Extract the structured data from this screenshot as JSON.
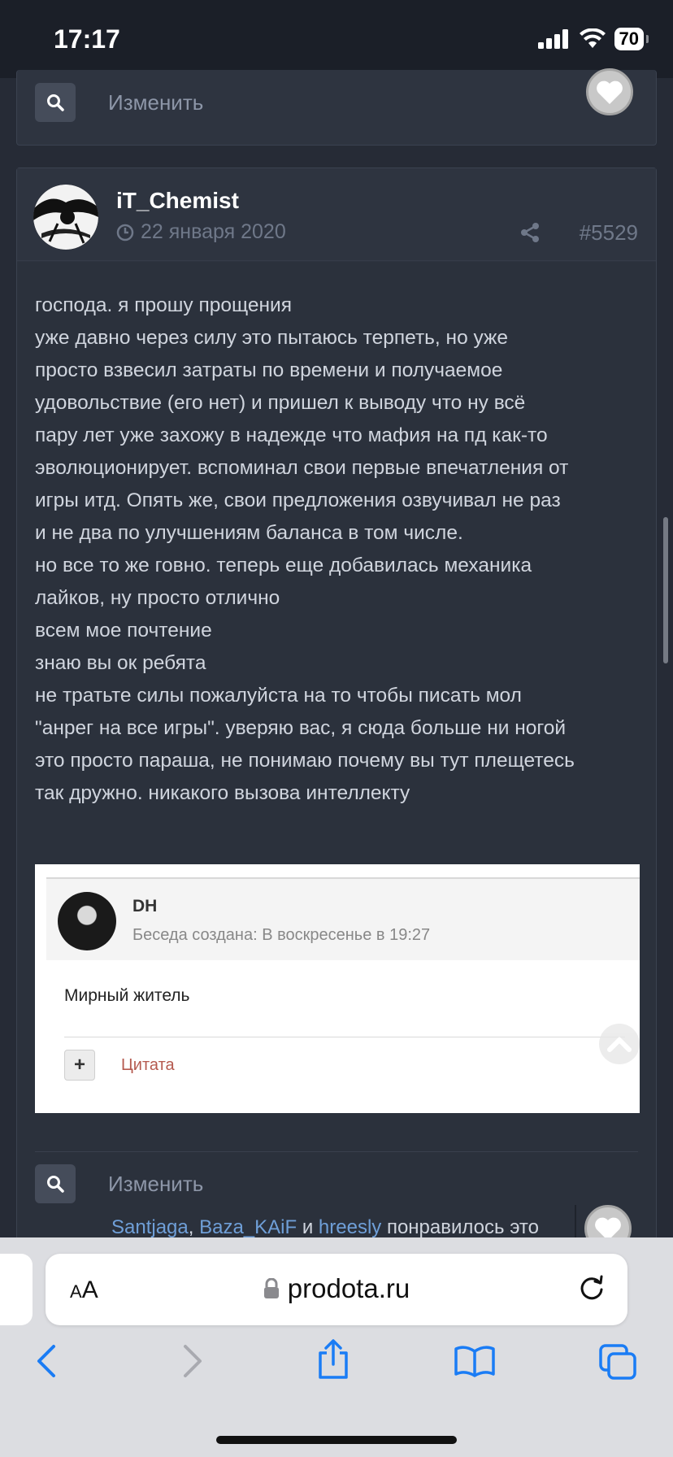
{
  "status": {
    "time": "17:17",
    "battery": "70"
  },
  "top_post": {
    "edit_label": "Изменить"
  },
  "post": {
    "author": "iT_Chemist",
    "date": "22 января 2020",
    "number": "#5529",
    "lines": [
      "господа. я прошу прощения",
      "уже давно через силу это пытаюсь терпеть, но уже",
      "просто взвесил затраты по времени и получаемое",
      "удовольствие (его нет) и пришел к выводу что ну всё",
      "пару лет уже захожу в надежде что мафия на пд как-то",
      "эволюционирует. вспоминал свои первые впечатления от",
      "игры итд. Опять же, свои предложения озвучивал не раз",
      "и не два по улучшениям баланса в том числе.",
      "но все то же говно. теперь еще добавилась механика",
      "лайков, ну просто отлично",
      "всем мое почтение",
      "знаю вы ок ребята",
      "не тратьте силы пожалуйста на то чтобы писать мол",
      "\"анрег на все игры\". уверяю вас, я сюда больше ни ногой",
      "это просто параша, не понимаю почему вы тут плещетесь",
      "так дружно. никакого вызова интеллекту"
    ],
    "embed": {
      "name": "DH",
      "subtitle": "Беседа создана: В воскресенье в 19:27",
      "role": "Мирный житель",
      "quote_label": "Цитата",
      "plus": "+"
    },
    "edit_label": "Изменить",
    "likes": {
      "users": [
        "Santjaga",
        "Baza_KAiF",
        "hreesly"
      ],
      "separator": ",",
      "and": "и",
      "suffix": "понравилось это"
    }
  },
  "browser": {
    "aa_small": "A",
    "aa_large": "A",
    "url": "prodota.ru"
  },
  "colors": {
    "background": "#262b36",
    "card": "#2e3440",
    "link": "#6f9fd8",
    "quote": "#b55a4f",
    "safari_blue": "#1a7cf5"
  }
}
